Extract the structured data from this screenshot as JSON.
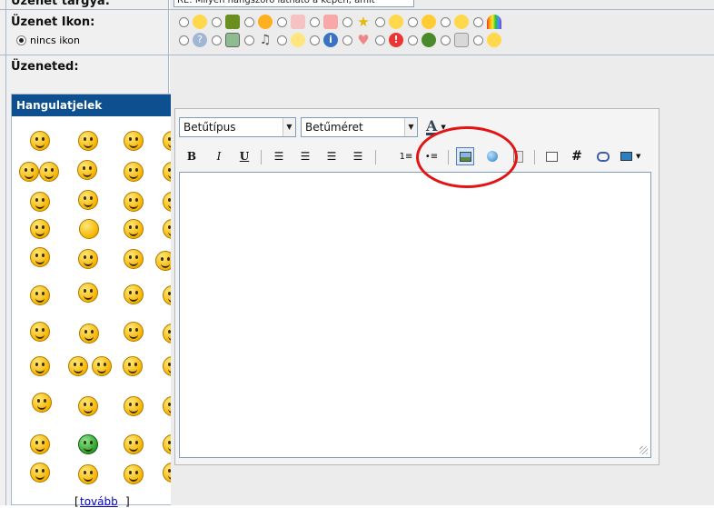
{
  "form": {
    "subject_label": "Üzenet tárgya:",
    "subject_value": "RE: Milyen hangszóró látható a képen, amit",
    "icon_label": "Üzenet Ikon:",
    "none_label": "nincs ikon",
    "message_label": "Üzeneted:"
  },
  "smilies": {
    "header": "Hangulatjelek",
    "more_link": "tovább",
    "bracket_open": "[",
    "bracket_close": "]"
  },
  "message_icons": {
    "row1": [
      "smile-face-icon",
      "film-icon",
      "arrow-right-icon",
      "thumbs-up-icon",
      "thumbs-down-icon",
      "star-icon",
      "wink-icon",
      "nose-icon",
      "sad-icon",
      "rainbow-icon"
    ],
    "row2": [
      "question-icon",
      "picture-icon",
      "music-icon",
      "lightbulb-icon",
      "info-icon",
      "heart-icon",
      "exclamation-icon",
      "bug-icon",
      "cube-icon",
      "smile-small-icon"
    ]
  },
  "editor": {
    "font_select": "Betűtípus",
    "size_select": "Betűméret",
    "font_color_glyph": "A",
    "bold_glyph": "B",
    "italic_glyph": "I",
    "underline_glyph": "U",
    "hash_glyph": "#",
    "active_button": "insert-image-button"
  },
  "colors": {
    "header_bg": "#0e4f8f",
    "link": "#0000cc",
    "annotation": "#e21414"
  }
}
